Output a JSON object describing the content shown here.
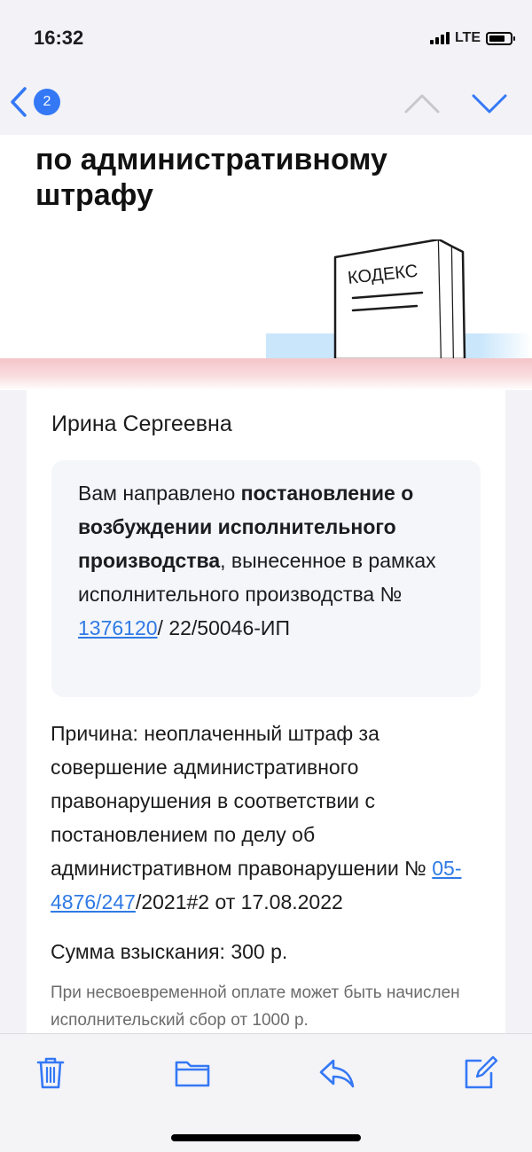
{
  "status_bar": {
    "time": "16:32",
    "network": "LTE"
  },
  "nav": {
    "unread_count": "2"
  },
  "email": {
    "title": "по административному штрафу",
    "book_label": "КОДЕКС",
    "greeting": "Ирина Сергеевна",
    "notice": {
      "part1": "Вам направлено ",
      "bold": "постановление о возбуждении исполнительного производства",
      "part2": ", вынесенное в рамках исполнительного производства № ",
      "case_link": "1376120",
      "part3": "/ 22/50046-ИП"
    },
    "reason": {
      "text": "Причина: неоплаченный штраф за совершение административного правонарушения в соответствии с постановлением по делу об административном правонарушении № ",
      "case_link": "05-4876/247",
      "suffix": "/2021#2 от 17.08.2022"
    },
    "amount": "Сумма взыскания: 300 р.",
    "note": "При несвоевременной оплате может быть начислен исполнительский сбор от 1000 р."
  },
  "colors": {
    "accent": "#3478f6",
    "link": "#2f7ae5"
  }
}
